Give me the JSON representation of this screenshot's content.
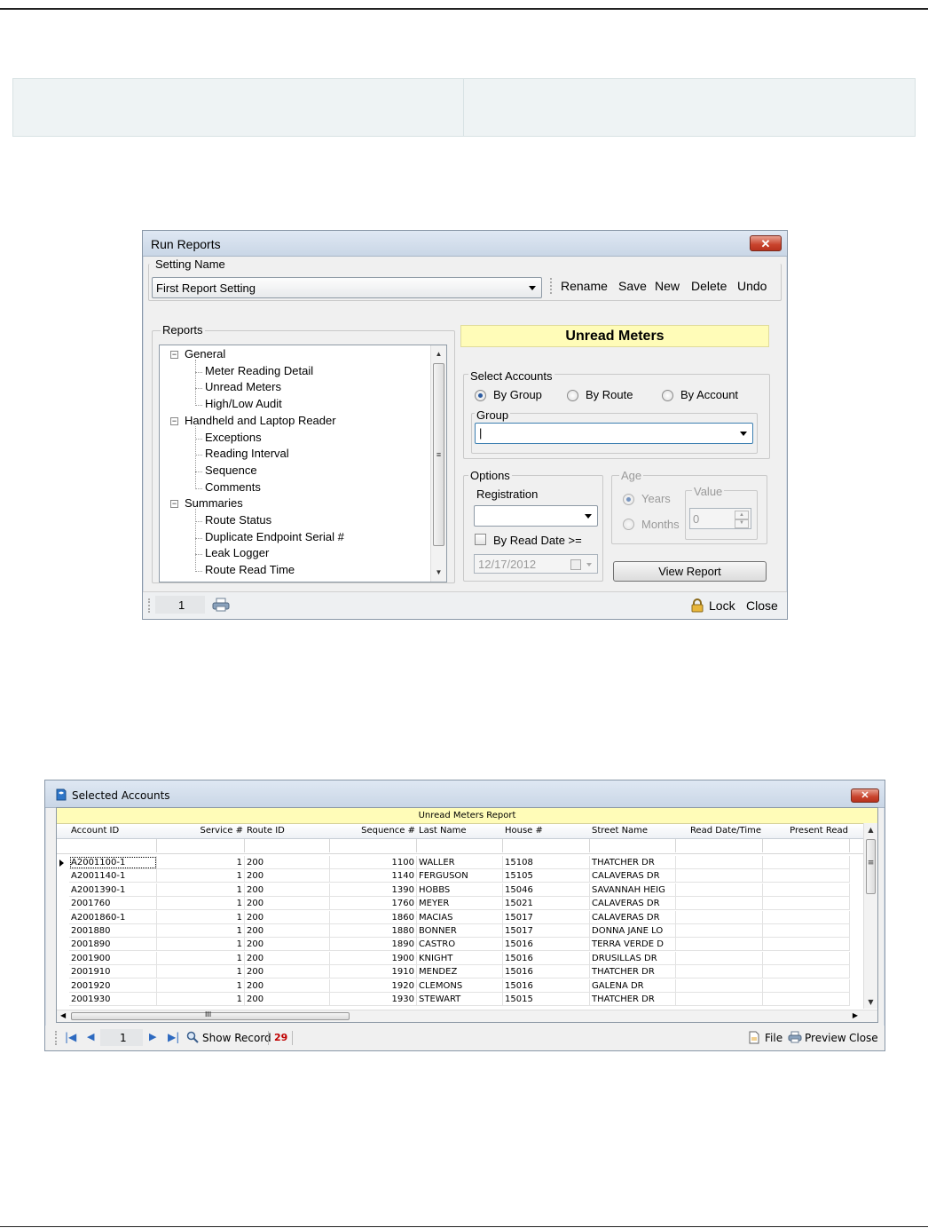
{
  "run_reports": {
    "title": "Run Reports",
    "close_glyph": "✕",
    "setting_name_label": "Setting Name",
    "setting_value": "First Report Setting",
    "toolbar": [
      "Rename",
      "Save",
      "New",
      "Delete",
      "Undo"
    ],
    "reports_label": "Reports",
    "tree": [
      {
        "label": "General",
        "level": 0,
        "expanded": true
      },
      {
        "label": "Meter Reading Detail",
        "level": 1
      },
      {
        "label": "Unread Meters",
        "level": 1
      },
      {
        "label": "High/Low Audit",
        "level": 1
      },
      {
        "label": "Handheld and Laptop Reader",
        "level": 0,
        "expanded": true
      },
      {
        "label": "Exceptions",
        "level": 1
      },
      {
        "label": "Reading Interval",
        "level": 1
      },
      {
        "label": "Sequence",
        "level": 1
      },
      {
        "label": "Comments",
        "level": 1
      },
      {
        "label": "Summaries",
        "level": 0,
        "expanded": true
      },
      {
        "label": "Route Status",
        "level": 1
      },
      {
        "label": "Duplicate Endpoint Serial #",
        "level": 1
      },
      {
        "label": "Leak Logger",
        "level": 1
      },
      {
        "label": "Route Read Time",
        "level": 1
      }
    ],
    "report_title": "Unread Meters",
    "select_accounts_label": "Select Accounts",
    "radio_by_group": "By Group",
    "radio_by_route": "By Route",
    "radio_by_account": "By Account",
    "selected_radio": "By Group",
    "group_label": "Group",
    "group_value": "|",
    "options_label": "Options",
    "registration_label": "Registration",
    "registration_value": "",
    "by_read_date_label": "By Read Date >=",
    "by_read_date_checked": false,
    "read_date_value": "12/17/2012",
    "age_label": "Age",
    "years_label": "Years",
    "months_label": "Months",
    "value_label": "Value",
    "value_value": "0",
    "view_report_label": "View Report",
    "page_number": "1",
    "lock_label": "Lock",
    "close_label": "Close",
    "accent_colors": {
      "report_banner": "#fffcb8",
      "close_button": "#c8432c"
    }
  },
  "selected_accounts": {
    "title": "Selected Accounts",
    "close_glyph": "✕",
    "report_title": "Unread Meters Report",
    "columns": [
      "Account ID",
      "Service #",
      "Route ID",
      "Sequence #",
      "Last Name",
      "House #",
      "Street Name",
      "Read Date/Time",
      "Present Read"
    ],
    "rows": [
      [
        "A2001100-1",
        "1",
        "200",
        "1100",
        "WALLER",
        "15108",
        "THATCHER DR",
        "",
        ""
      ],
      [
        "A2001140-1",
        "1",
        "200",
        "1140",
        "FERGUSON",
        "15105",
        "CALAVERAS DR",
        "",
        ""
      ],
      [
        "A2001390-1",
        "1",
        "200",
        "1390",
        "HOBBS",
        "15046",
        "SAVANNAH HEIG",
        "",
        ""
      ],
      [
        "2001760",
        "1",
        "200",
        "1760",
        "MEYER",
        "15021",
        "CALAVERAS DR",
        "",
        ""
      ],
      [
        "A2001860-1",
        "1",
        "200",
        "1860",
        "MACIAS",
        "15017",
        "CALAVERAS DR",
        "",
        ""
      ],
      [
        "2001880",
        "1",
        "200",
        "1880",
        "BONNER",
        "15017",
        "DONNA JANE LO",
        "",
        ""
      ],
      [
        "2001890",
        "1",
        "200",
        "1890",
        "CASTRO",
        "15016",
        "TERRA VERDE D",
        "",
        ""
      ],
      [
        "2001900",
        "1",
        "200",
        "1900",
        "KNIGHT",
        "15016",
        "DRUSILLAS DR",
        "",
        ""
      ],
      [
        "2001910",
        "1",
        "200",
        "1910",
        "MENDEZ",
        "15016",
        "THATCHER DR",
        "",
        ""
      ],
      [
        "2001920",
        "1",
        "200",
        "1920",
        "CLEMONS",
        "15016",
        "GALENA DR",
        "",
        ""
      ],
      [
        "2001930",
        "1",
        "200",
        "1930",
        "STEWART",
        "15015",
        "THATCHER DR",
        "",
        ""
      ]
    ],
    "hscroll_grip": "III",
    "page_number": "1",
    "show_record_label": "Show Record",
    "record_count": "29",
    "file_label": "File",
    "preview_label": "Preview",
    "close_label": "Close"
  }
}
